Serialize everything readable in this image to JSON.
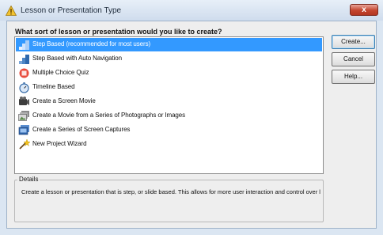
{
  "window": {
    "title": "Lesson or Presentation Type",
    "close_label": "x"
  },
  "dialog": {
    "question": "What sort of lesson or presentation would you like to create?",
    "items": [
      {
        "label": "Step Based (recommended for most users)",
        "icon": "steps-icon",
        "selected": true
      },
      {
        "label": "Step Based with Auto Navigation",
        "icon": "auto-navigation-icon",
        "selected": false
      },
      {
        "label": "Multiple Choice Quiz",
        "icon": "quiz-icon",
        "selected": false
      },
      {
        "label": "Timeline Based",
        "icon": "stopwatch-icon",
        "selected": false
      },
      {
        "label": "Create a Screen Movie",
        "icon": "film-camera-icon",
        "selected": false
      },
      {
        "label": "Create a Movie from a Series of Photographs or Images",
        "icon": "photo-stack-icon",
        "selected": false
      },
      {
        "label": "Create a Series of Screen Captures",
        "icon": "screen-captures-icon",
        "selected": false
      },
      {
        "label": "New Project Wizard",
        "icon": "wizard-wand-icon",
        "selected": false
      }
    ],
    "buttons": {
      "create": "Create...",
      "cancel": "Cancel",
      "help": "Help..."
    },
    "details": {
      "legend": "Details",
      "text": "Create a lesson or presentation that is step, or slide based. This allows for more user interaction and control over lesson flow."
    }
  },
  "colors": {
    "selection": "#3399ff",
    "close_button": "#c4452e"
  }
}
